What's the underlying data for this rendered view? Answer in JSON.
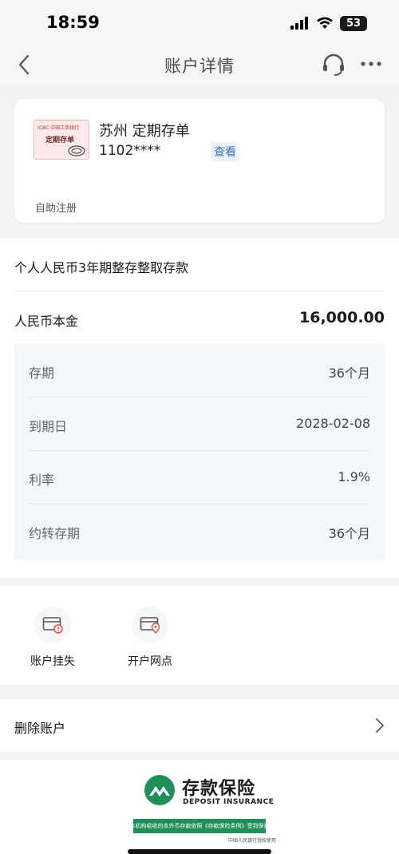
{
  "status_bar": {
    "time": "18:59",
    "battery": "53"
  },
  "nav": {
    "title": "账户详情"
  },
  "card": {
    "passbook_bank": "ICBC 中国工商银行",
    "passbook_name": "定期存单",
    "title": "苏州 定期存单",
    "number": "1102****",
    "view_label": "查看",
    "tag": "自助注册"
  },
  "info": {
    "product_name": "个人人民币3年期整存整取存款",
    "principal_label": "人民币本金",
    "principal_value": "16,000.00",
    "details": [
      {
        "label": "存期",
        "value": "36个月"
      },
      {
        "label": "到期日",
        "value": "2028-02-08"
      },
      {
        "label": "利率",
        "value": "1.9%"
      },
      {
        "label": "约转存期",
        "value": "36个月"
      }
    ]
  },
  "actions": [
    {
      "label": "账户挂失",
      "icon": "card-lost-icon"
    },
    {
      "label": "开户网点",
      "icon": "branch-location-icon"
    }
  ],
  "delete": {
    "label": "删除账户"
  },
  "insurance": {
    "title": "存款保险",
    "subtitle": "DEPOSIT INSURANCE",
    "banner": "本机构吸收的本外币存款依照《存款保险条例》受到保护",
    "note": "中国人民银行授权使用",
    "brand_color": "#1f8f5a"
  }
}
